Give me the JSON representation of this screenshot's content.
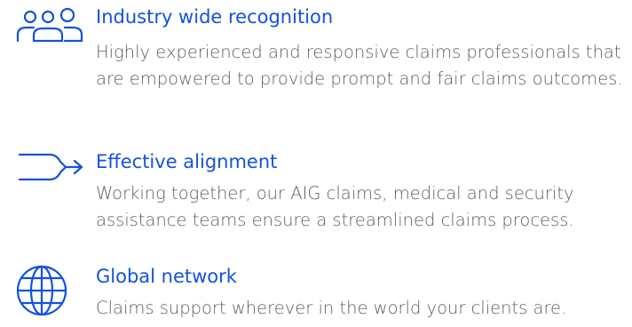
{
  "colors": {
    "accent": "#1352de",
    "body": "#5e5e5e",
    "icon": "#1352de"
  },
  "features": [
    {
      "icon": "people-icon",
      "title": "Industry wide recognition",
      "description": "Highly experienced and responsive claims professionals that are empowered to provide prompt and fair claims outcomes."
    },
    {
      "icon": "arrow-right-icon",
      "title": "Effective alignment",
      "description": "Working together, our AIG claims, medical and security assistance teams ensure a streamlined claims process."
    },
    {
      "icon": "globe-icon",
      "title": "Global network",
      "description": "Claims support wherever in the world your clients are."
    }
  ]
}
